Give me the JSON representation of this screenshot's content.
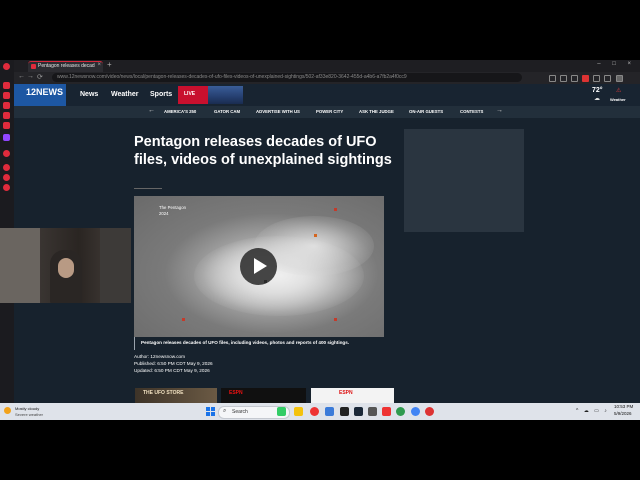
{
  "browser": {
    "tab_title": "Pentagon releases decad",
    "tab_close": "×",
    "new_tab": "+",
    "window_controls": "– □ ×",
    "url": "www.12newsnow.com/video/news/local/pentagon-releases-decades-of-ufo-files-videos-of-unexplained-sightings/502-af33e820-3642-455d-a4b6-a7fb2a4f0cc9",
    "nav": {
      "back": "←",
      "forward": "→",
      "reload": "⟳"
    }
  },
  "site": {
    "logo": "12NEWS",
    "nav": [
      "News",
      "Weather",
      "Sports"
    ],
    "live_label": "LIVE",
    "weather": {
      "temp": "72°",
      "icon": "☁",
      "label": "Weather",
      "alert": "⚠"
    },
    "subnav": [
      "AMERICA'S 250",
      "GATOR CAM",
      "ADVERTISE WITH US",
      "POWER CITY",
      "ASK THE JUDGE",
      "ON-AIR GUESTS",
      "CONTESTS"
    ],
    "subnav_prev": "←",
    "subnav_next": "→"
  },
  "article": {
    "headline": "Pentagon releases decades of UFO files, videos of unexplained sightings",
    "video_overlay": [
      "The Pentagon",
      "2024"
    ],
    "caption": "Pentagon releases decades of UFO files, including videos, photos and reports of 400 sightings.",
    "author": "Author: 12newsnow.com",
    "published": "Published: 6:50 PM CDT May 9, 2026",
    "updated": "Updated: 6:50 PM CDT May 9, 2026"
  },
  "thumbnails": [
    {
      "label": "THE UFO STORE"
    },
    {
      "label": "ESPN"
    },
    {
      "label": "ESPN"
    }
  ],
  "taskbar": {
    "weather_line1": "Mostly cloudy",
    "weather_line2": "Severe weather",
    "search_label": "Search",
    "search_icon": "⌕",
    "tray": "^ ☁ ▭ ♪",
    "time": "10:53 PM",
    "date": "5/9/2026"
  },
  "colors": {
    "accent_red": "#c8102e",
    "logo_blue": "#1d57a3",
    "page_bg": "#17222d",
    "windows_blue": "#1a73e8"
  }
}
